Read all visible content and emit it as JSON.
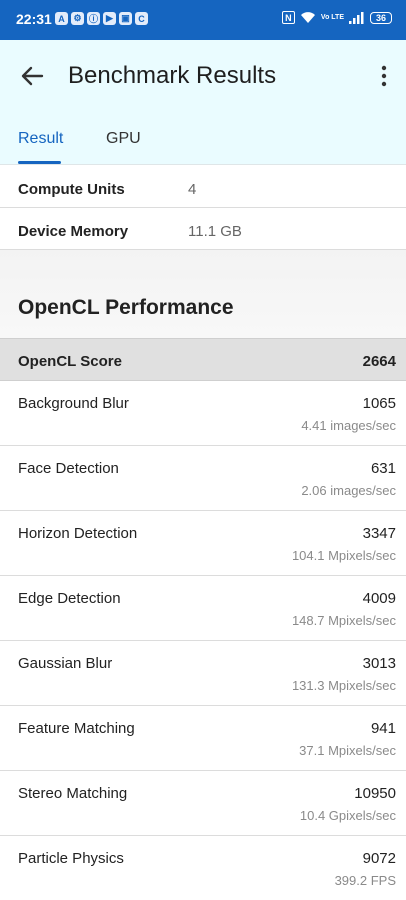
{
  "status_bar": {
    "time": "22:31",
    "battery": "36",
    "nfc": "N",
    "volte": "Vo LTE",
    "notification_icons": [
      "A",
      "⚙",
      "ⓘ",
      "▶",
      "▣",
      "C"
    ]
  },
  "app_bar": {
    "title": "Benchmark Results",
    "tabs": [
      {
        "label": "Result",
        "selected": true
      },
      {
        "label": "GPU",
        "selected": false
      }
    ]
  },
  "device_info": [
    {
      "label": "Compute Units",
      "value": "4"
    },
    {
      "label": "Device Memory",
      "value": "11.1 GB"
    }
  ],
  "section": {
    "title": "OpenCL Performance",
    "score_label": "OpenCL Score",
    "score_value": "2664"
  },
  "benchmarks": [
    {
      "name": "Background Blur",
      "score": "1065",
      "rate": "4.41 images/sec"
    },
    {
      "name": "Face Detection",
      "score": "631",
      "rate": "2.06 images/sec"
    },
    {
      "name": "Horizon Detection",
      "score": "3347",
      "rate": "104.1 Mpixels/sec"
    },
    {
      "name": "Edge Detection",
      "score": "4009",
      "rate": "148.7 Mpixels/sec"
    },
    {
      "name": "Gaussian Blur",
      "score": "3013",
      "rate": "131.3 Mpixels/sec"
    },
    {
      "name": "Feature Matching",
      "score": "941",
      "rate": "37.1 Mpixels/sec"
    },
    {
      "name": "Stereo Matching",
      "score": "10950",
      "rate": "10.4 Gpixels/sec"
    },
    {
      "name": "Particle Physics",
      "score": "9072",
      "rate": "399.2 FPS"
    }
  ],
  "colors": {
    "status_bar": "#1565c0",
    "app_bar": "#eafcff",
    "accent": "#1565c0",
    "score_row": "#e0e0e0"
  }
}
